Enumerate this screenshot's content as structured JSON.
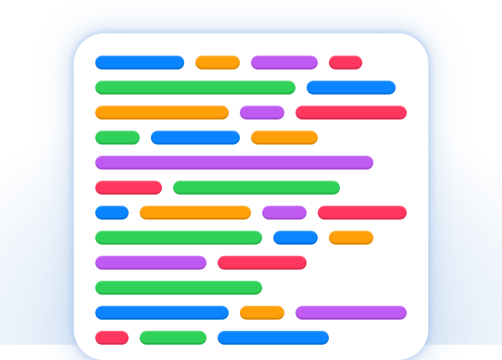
{
  "colors": {
    "blue": "#0a84ff",
    "orange": "#ff9f0a",
    "purple": "#bf5af2",
    "red": "#ff375f",
    "green": "#30d158"
  },
  "rows": [
    [
      "blue",
      "orange",
      "purple",
      "red"
    ],
    [
      "green",
      "blue"
    ],
    [
      "orange",
      "purple",
      "red"
    ],
    [
      "green",
      "blue",
      "orange"
    ],
    [
      "purple"
    ],
    [
      "red",
      "green"
    ],
    [
      "blue",
      "orange",
      "purple",
      "red"
    ],
    [
      "green",
      "blue",
      "orange"
    ],
    [
      "purple",
      "red"
    ],
    [
      "green"
    ],
    [
      "blue",
      "orange",
      "purple"
    ],
    [
      "red",
      "green",
      "blue"
    ]
  ]
}
